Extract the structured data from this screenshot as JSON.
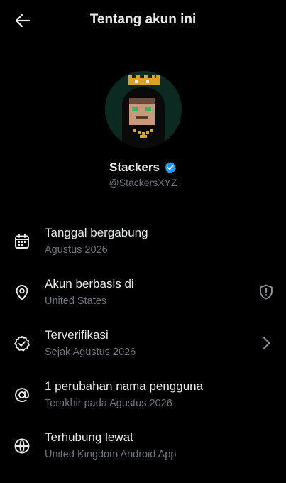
{
  "header": {
    "title": "Tentang akun ini"
  },
  "profile": {
    "name": "Stackers",
    "handle": "@StackersXYZ"
  },
  "colors": {
    "verified": "#1d9bf0",
    "muted": "#71767b",
    "text": "#e7e9ea",
    "background": "#000000"
  },
  "rows": [
    {
      "title": "Tanggal bergabung",
      "subtitle": "Agustus 2026",
      "icon": "calendar-icon"
    },
    {
      "title": "Akun berbasis di",
      "subtitle": "United States",
      "icon": "location-pin-icon",
      "trailing_icon": "shield-alert-icon"
    },
    {
      "title": "Terverifikasi",
      "subtitle": "Sejak Agustus 2026",
      "icon": "verified-badge-icon",
      "trailing_icon": "chevron-right-icon"
    },
    {
      "title": "1 perubahan nama pengguna",
      "subtitle": "Terakhir pada Agustus 2026",
      "icon": "at-sign-icon"
    },
    {
      "title": "Terhubung lewat",
      "subtitle": "United Kingdom Android App",
      "icon": "globe-icon"
    }
  ]
}
